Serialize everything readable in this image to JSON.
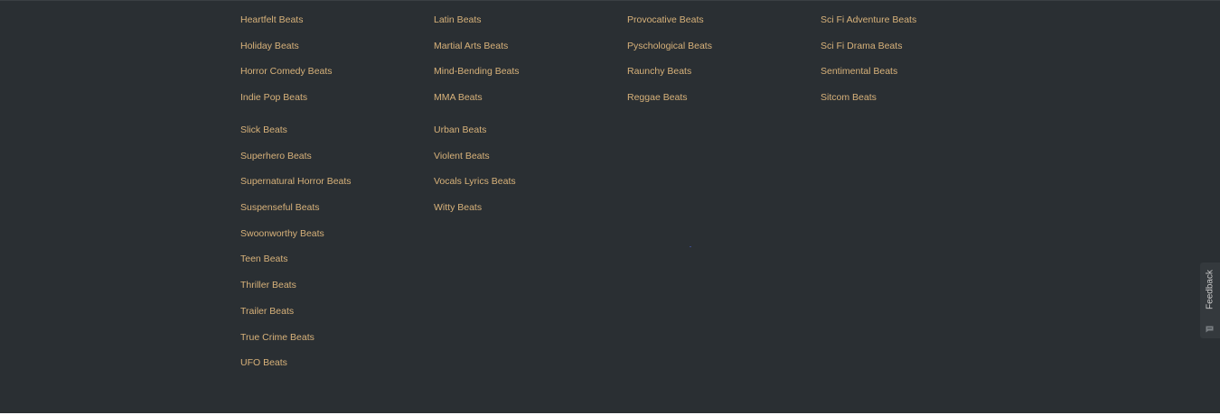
{
  "group_a": {
    "columns": [
      [
        "Heartfelt Beats",
        "Holiday Beats",
        "Horror Comedy Beats",
        "Indie Pop Beats"
      ],
      [
        "Latin Beats",
        "Martial Arts Beats",
        "Mind-Bending Beats",
        "MMA Beats"
      ],
      [
        "Provocative Beats",
        "Pyschological Beats",
        "Raunchy Beats",
        "Reggae Beats"
      ],
      [
        "Sci Fi Adventure Beats",
        "Sci Fi Drama Beats",
        "Sentimental Beats",
        "Sitcom Beats"
      ]
    ]
  },
  "group_b": {
    "columns": [
      [
        "Slick Beats",
        "Superhero Beats",
        "Supernatural Horror Beats",
        "Suspenseful Beats",
        "Swoonworthy Beats",
        "Teen Beats",
        "Thriller Beats",
        "Trailer Beats",
        "True Crime Beats",
        "UFO Beats"
      ],
      [
        "Urban Beats",
        "Violent Beats",
        "Vocals Lyrics Beats",
        "Witty Beats"
      ]
    ]
  },
  "feedback": {
    "label": "Feedback",
    "icon": "chat-bubble-icon"
  },
  "colors": {
    "background": "#2a2f33",
    "link": "#d8b27a",
    "feedback_tab": "#34393d"
  }
}
